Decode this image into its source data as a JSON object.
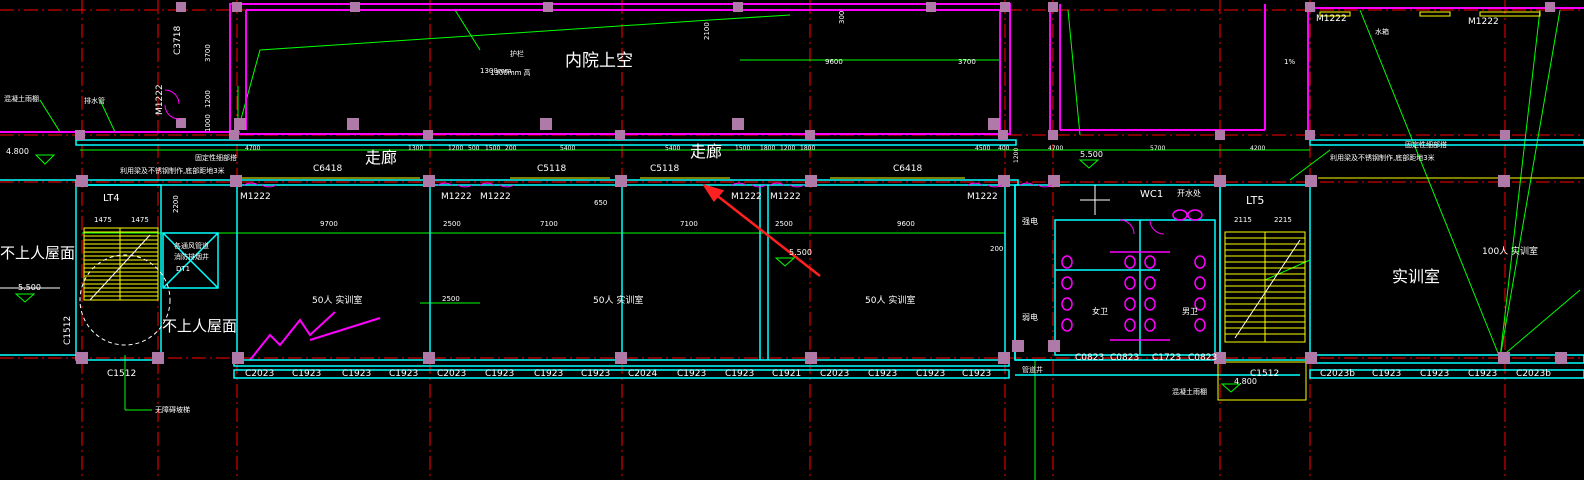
{
  "drawing": {
    "rooms": {
      "courtyard": "内院上空",
      "corridor_left": "走廊",
      "corridor_right": "走廊",
      "classroom_1": "50人 实训室",
      "classroom_2": "50人 实训室",
      "classroom_3": "50人 实训室",
      "lab_right": "实训室",
      "lab_right_cap": "100人 实训室",
      "roof_left": "不上人屋面",
      "roof_center": "不上人屋面",
      "wc": "WC1",
      "water_room": "开水处",
      "womens": "女卫",
      "mens": "男卫",
      "strong_elec": "强电",
      "weak_elec": "弱电"
    },
    "stairs": {
      "left": "LT4",
      "right": "LT5"
    },
    "doors": [
      "M1222",
      "M1222",
      "M1222",
      "M1222",
      "M1222",
      "M1222",
      "M1222",
      "M1222",
      "M1222"
    ],
    "top_windows": [
      "C6418",
      "C5118",
      "C5118",
      "C6418"
    ],
    "bottom_windows": [
      "C2023",
      "C1923",
      "C1923",
      "C1923",
      "C2023",
      "C1923",
      "C1923",
      "C1923",
      "C2024",
      "C1923",
      "C1923",
      "C1921",
      "C2023",
      "C1923",
      "C1923",
      "C1923",
      "C0823",
      "C0823",
      "C1723",
      "C0823",
      "C2023b",
      "C1923",
      "C1923",
      "C1923",
      "C2023b"
    ],
    "side_windows": [
      "C1512",
      "C1512",
      "C1512",
      "C3718"
    ],
    "dims_corridor": [
      "4700",
      "1300",
      "1200",
      "500",
      "1500",
      "200",
      "5400",
      "5400",
      "1500",
      "1800",
      "1200",
      "1800",
      "4500",
      "400",
      "1200",
      "4700",
      "5700",
      "4200"
    ],
    "dims_rooms": [
      "9700",
      "2500",
      "7100",
      "7100",
      "2500",
      "9600"
    ],
    "dims_misc": [
      "650",
      "2500",
      "2200",
      "200",
      "1300mm",
      "9600",
      "3700",
      "2100",
      "3700",
      "1200",
      "1000",
      "300"
    ],
    "elevations": [
      "5.500",
      "5.500",
      "4.800",
      "5.500",
      "4.800"
    ],
    "notes": {
      "note1": "利用梁及不锈钢制作,底部距地3米",
      "note2": "固定性细部搭",
      "note3": "利用梁及不锈钢制作,底部距地3米",
      "note4": "固定性细部搭",
      "railing": "护栏",
      "railing_h": "1300mm 高",
      "concrete_canopy_l": "混凝土雨棚",
      "concrete_canopy_r": "混凝土雨棚",
      "ramp": "无障碍坡梯",
      "water_pipe": "排水管",
      "water_tank": "水箱",
      "pipe_shaft": "管道井",
      "shaft_label": "各通风管道",
      "shaft_label2": "消防排烟井",
      "lift": "DT1",
      "stair_dim1": "1475",
      "stair_dim2": "1475",
      "stair_dim3": "2115",
      "stair_dim4": "2215",
      "pct": "1%"
    },
    "colors": {
      "background": "#000000",
      "wall": "#00ffff",
      "magenta": "#ff00ff",
      "axis_red": "#ff0000",
      "green": "#00ff00",
      "yellow": "#ffff00",
      "white": "#ffffff",
      "column": "#b07aa8",
      "arrow": "#ff2020"
    }
  }
}
